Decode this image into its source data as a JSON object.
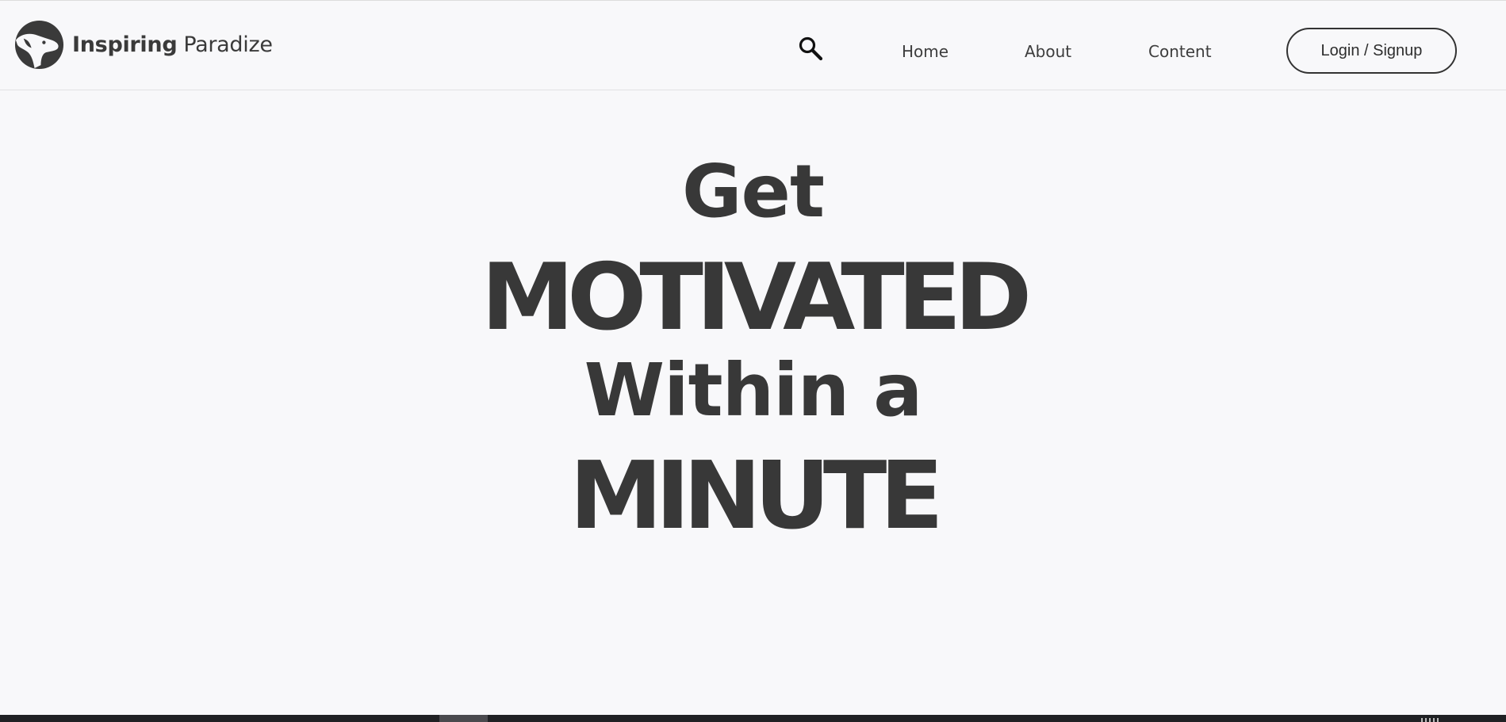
{
  "brand": {
    "name_bold": "Inspiring",
    "name_light": "Paradize",
    "logo_icon": "dog-head-logo-icon"
  },
  "nav": {
    "search_icon": "search-icon",
    "links": [
      {
        "label": "Home"
      },
      {
        "label": "About"
      },
      {
        "label": "Content"
      }
    ],
    "login_label": "Login / Signup"
  },
  "hero": {
    "line1": "Get",
    "line2": "MOTIVATED",
    "line3": "Within a",
    "line4": "MINUTE"
  },
  "colors": {
    "background": "#f8f8fa",
    "text": "#383838",
    "taskbar": "#202124"
  }
}
